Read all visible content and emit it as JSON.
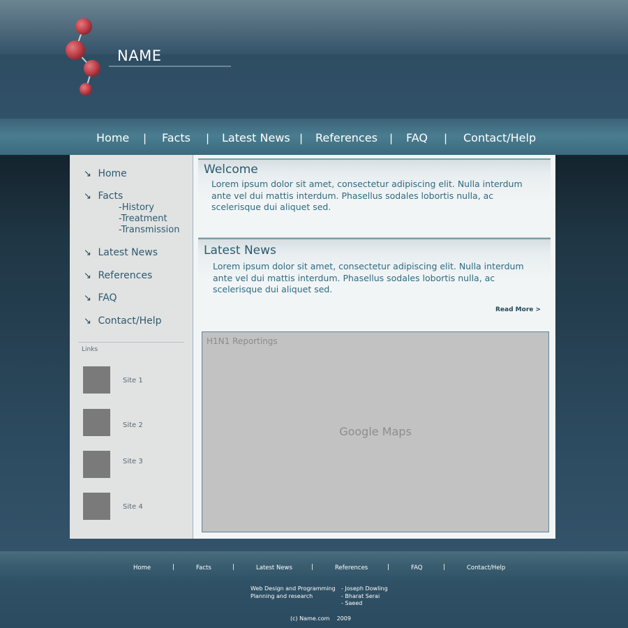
{
  "header": {
    "site_name": "NAME"
  },
  "nav": {
    "items": [
      "Home",
      "Facts",
      "Latest News",
      "References",
      "FAQ",
      "Contact/Help"
    ]
  },
  "sidebar": {
    "items": [
      {
        "label": "Home"
      },
      {
        "label": "Facts",
        "subitems": [
          "-History",
          "-Treatment",
          "-Transmission"
        ]
      },
      {
        "label": "Latest News"
      },
      {
        "label": "References"
      },
      {
        "label": "FAQ"
      },
      {
        "label": "Contact/Help"
      }
    ],
    "arrow_glyph": "↘",
    "links_label": "Links",
    "links": [
      "Site 1",
      "Site 2",
      "Site 3",
      "Site 4"
    ]
  },
  "welcome": {
    "title": "Welcome",
    "text": "Lorem ipsum dolor sit amet, consectetur adipiscing elit. Nulla interdum ante vel dui mattis interdum. Phasellus sodales lobortis nulla, ac scelerisque dui aliquet sed."
  },
  "latest_news": {
    "title": "Latest News",
    "text": "Lorem ipsum dolor sit amet, consectetur adipiscing elit. Nulla interdum ante vel dui mattis interdum. Phasellus sodales lobortis nulla, ac scelerisque dui aliquet sed.",
    "read_more": "Read More >"
  },
  "map": {
    "title": "H1N1 Reportings",
    "label": "Google Maps"
  },
  "footer": {
    "nav": [
      "Home",
      "Facts",
      "Latest News",
      "References",
      "FAQ",
      "Contact/Help"
    ],
    "credits_left": [
      "Web Design and Programming",
      "Planning and research"
    ],
    "credits_right": [
      "- Joseph Dowling",
      "- Bharat Serai",
      "- Saeed"
    ],
    "copyright": "(c) Name.com    2009"
  },
  "colors": {
    "header_bg": "#2d4c63",
    "nav_bg": "#4a7d90",
    "accent_text": "#2a5a6e",
    "sidebar_bg": "#e1e3e3",
    "map_bg": "#c2c2c2",
    "logo_ball": "#c8474f"
  }
}
